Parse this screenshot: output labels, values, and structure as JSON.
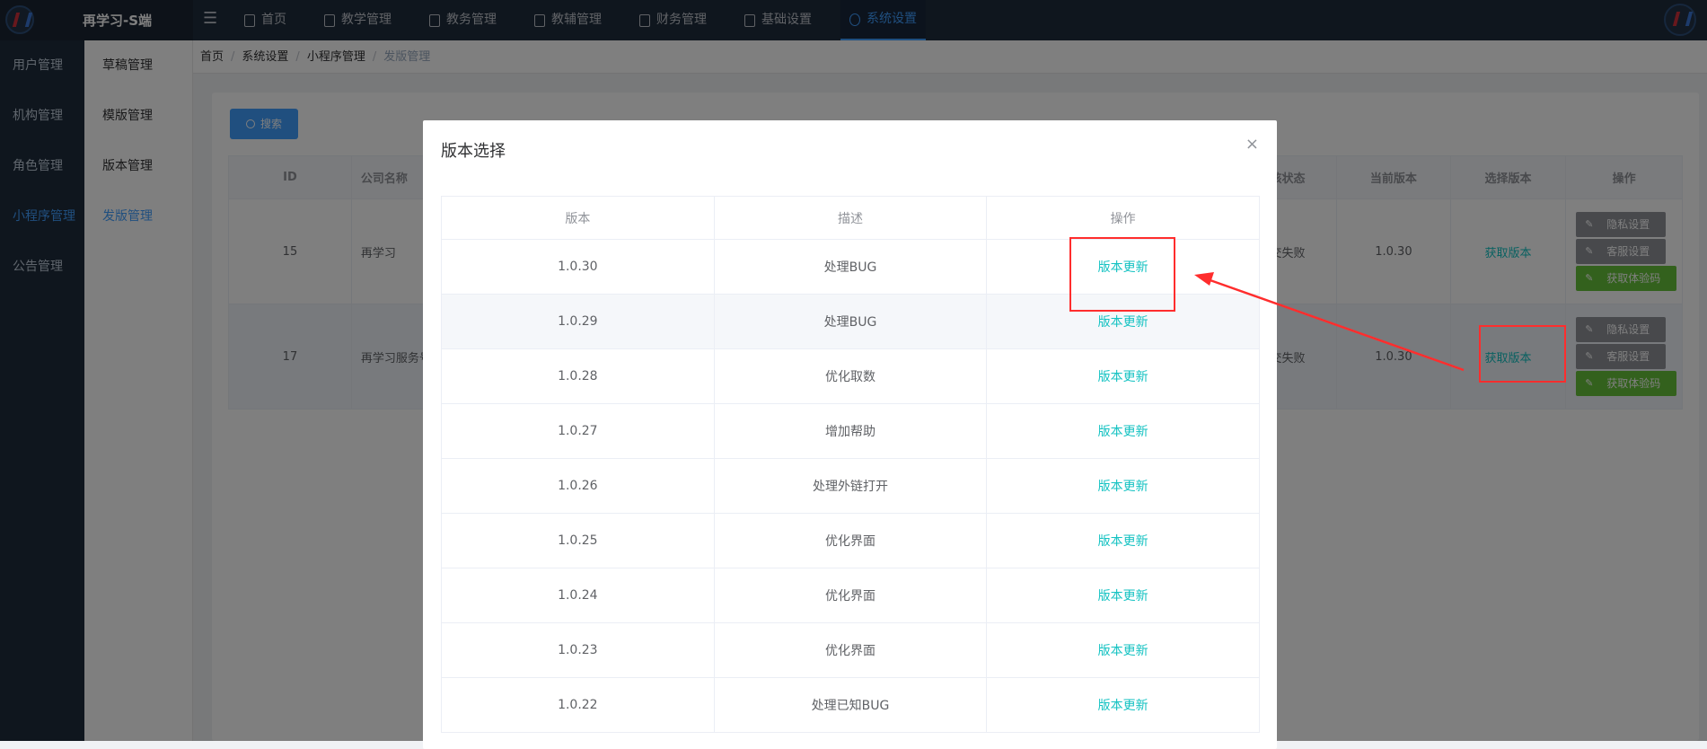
{
  "app": {
    "title": "再学习-S端"
  },
  "topnav": [
    {
      "label": "首页",
      "active": false
    },
    {
      "label": "教学管理",
      "active": false
    },
    {
      "label": "教务管理",
      "active": false
    },
    {
      "label": "教辅管理",
      "active": false
    },
    {
      "label": "财务管理",
      "active": false
    },
    {
      "label": "基础设置",
      "active": false
    },
    {
      "label": "系统设置",
      "active": true
    }
  ],
  "sidebar_primary": [
    {
      "label": "用户管理"
    },
    {
      "label": "机构管理"
    },
    {
      "label": "角色管理"
    },
    {
      "label": "小程序管理",
      "active": true
    },
    {
      "label": "公告管理"
    }
  ],
  "sidebar_secondary": [
    {
      "label": "草稿管理"
    },
    {
      "label": "模版管理"
    },
    {
      "label": "版本管理"
    },
    {
      "label": "发版管理",
      "active": true
    }
  ],
  "breadcrumb": [
    "首页",
    "系统设置",
    "小程序管理",
    "发版管理"
  ],
  "toolbar": {
    "search_label": "搜索"
  },
  "list": {
    "columns": {
      "id": "ID",
      "company": "公司名称",
      "status": "审核状态",
      "current": "当前版本",
      "select": "选择版本",
      "ops": "操作"
    },
    "rows": [
      {
        "id": "15",
        "company": "再学习",
        "status": "提交失败",
        "current": "1.0.30",
        "select": "获取版本"
      },
      {
        "id": "17",
        "company": "再学习服务号",
        "status": "提交失败",
        "current": "1.0.30",
        "select": "获取版本"
      }
    ],
    "op_buttons": {
      "privacy": "隐私设置",
      "service": "客服设置",
      "qrcode": "获取体验码"
    }
  },
  "dialog": {
    "title": "版本选择",
    "close": "×",
    "columns": {
      "version": "版本",
      "desc": "描述",
      "action": "操作"
    },
    "rows": [
      {
        "version": "1.0.30",
        "desc": "处理BUG",
        "action": "版本更新"
      },
      {
        "version": "1.0.29",
        "desc": "处理BUG",
        "action": "版本更新"
      },
      {
        "version": "1.0.28",
        "desc": "优化取数",
        "action": "版本更新"
      },
      {
        "version": "1.0.27",
        "desc": "增加帮助",
        "action": "版本更新"
      },
      {
        "version": "1.0.26",
        "desc": "处理外链打开",
        "action": "版本更新"
      },
      {
        "version": "1.0.25",
        "desc": "优化界面",
        "action": "版本更新"
      },
      {
        "version": "1.0.24",
        "desc": "优化界面",
        "action": "版本更新"
      },
      {
        "version": "1.0.23",
        "desc": "优化界面",
        "action": "版本更新"
      },
      {
        "version": "1.0.22",
        "desc": "处理已知BUG",
        "action": "版本更新"
      }
    ]
  },
  "colors": {
    "accent": "#409eff",
    "link": "#13c2c2",
    "annotation": "#ff2d2d",
    "nav_bg": "#1f2d3d"
  },
  "icons": {
    "logo": "logo-icon",
    "menu": "menu-toggle-icon",
    "search": "search-icon",
    "close": "close-icon",
    "edit": "edit-icon"
  }
}
